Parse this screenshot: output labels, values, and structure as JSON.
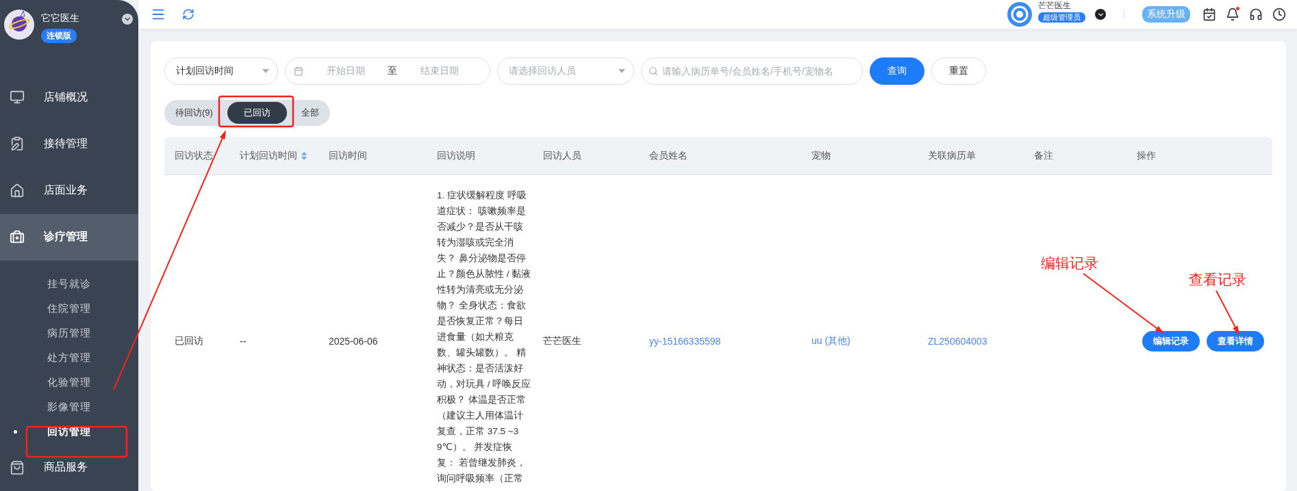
{
  "brand": {
    "name": "它它医生",
    "edition": "连锁版"
  },
  "sidebar": {
    "items": [
      {
        "label": "店铺概况",
        "selected": false,
        "expanded": false
      },
      {
        "label": "接待管理",
        "selected": false,
        "expanded": false
      },
      {
        "label": "店面业务",
        "selected": false,
        "expanded": false
      },
      {
        "label": "诊疗管理",
        "selected": true,
        "expanded": true,
        "children": [
          {
            "label": "挂号就诊",
            "selected": false
          },
          {
            "label": "住院管理",
            "selected": false
          },
          {
            "label": "病历管理",
            "selected": false
          },
          {
            "label": "处方管理",
            "selected": false
          },
          {
            "label": "化验管理",
            "selected": false
          },
          {
            "label": "影像管理",
            "selected": false
          },
          {
            "label": "回访管理",
            "selected": true
          }
        ]
      },
      {
        "label": "商品服务",
        "selected": false,
        "expanded": false
      }
    ]
  },
  "topbar": {
    "user_name": "芒芒医生",
    "user_role": "超级管理员",
    "upgrade_button": "系统升级",
    "has_notification": true
  },
  "filters": {
    "time_type": "计划回访时间",
    "start_placeholder": "开始日期",
    "range_separator": "至",
    "end_placeholder": "结束日期",
    "staff_placeholder": "请选择回访人员",
    "search_placeholder": "请输入病历单号/会员姓名/手机号/宠物名",
    "query_button": "查询",
    "reset_button": "重置"
  },
  "tabs": [
    {
      "label": "待回访(9)",
      "selected": false
    },
    {
      "label": "已回访",
      "selected": true
    },
    {
      "label": "全部",
      "selected": false
    }
  ],
  "table": {
    "columns": [
      {
        "label": "回访状态",
        "sortable": false
      },
      {
        "label": "计划回访时间",
        "sortable": true
      },
      {
        "label": "回访时间",
        "sortable": false
      },
      {
        "label": "回访说明",
        "sortable": false
      },
      {
        "label": "回访人员",
        "sortable": false
      },
      {
        "label": "会员姓名",
        "sortable": false
      },
      {
        "label": "宠物",
        "sortable": false
      },
      {
        "label": "关联病历单",
        "sortable": false
      },
      {
        "label": "备注",
        "sortable": false
      },
      {
        "label": "操作",
        "sortable": false
      }
    ],
    "rows": [
      {
        "status": "已回访",
        "planned_time": "--",
        "visit_time": "2025-06-06",
        "description": "1. 症状缓解程度 呼吸道症状： 咳嗽频率是否减少？是否从干咳转为湿咳或完全消失？ 鼻分泌物是否停止？颜色从脓性 / 黏液性转为清亮或无分泌物？ 全身状态：食欲是否恢复正常？每日进食量（如犬粮克数、罐头罐数）。 精神状态：是否活泼好动，对玩具 / 呼唤反应积极？ 体温是否正常（建议主人用体温计复查，正常 37.5 ~39℃）。 并发症恢复： 若曾继发肺炎，询问呼吸频率（正常",
        "staff": "芒芒医生",
        "member": "yy-15166335598",
        "pet": "uu (其他)",
        "record": "ZL250604003",
        "note": "",
        "actions": [
          "编辑记录",
          "查看详情"
        ]
      }
    ]
  },
  "annotations": [
    {
      "text": "编辑记录"
    },
    {
      "text": "查看记录"
    }
  ]
}
